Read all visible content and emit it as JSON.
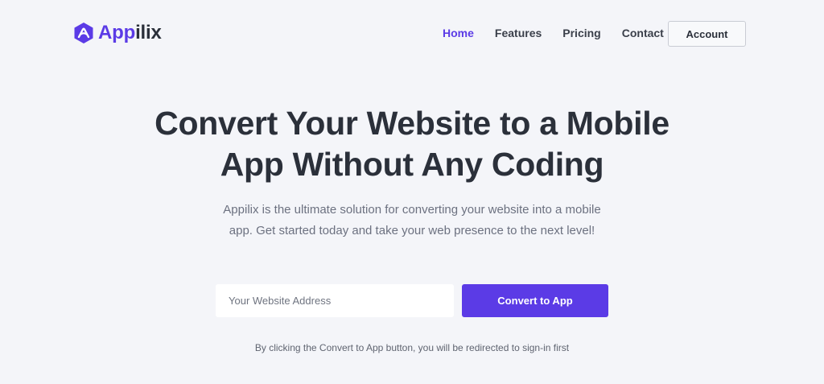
{
  "brand": {
    "name_part1": "App",
    "name_part2": "ilix",
    "accent_color": "#5b3be6",
    "logo_icon": "hexagon-logo-icon"
  },
  "nav": {
    "items": [
      {
        "label": "Home",
        "active": true
      },
      {
        "label": "Features",
        "active": false
      },
      {
        "label": "Pricing",
        "active": false
      },
      {
        "label": "Contact",
        "active": false
      }
    ],
    "account_label": "Account"
  },
  "hero": {
    "title_line1": "Convert Your Website to a Mobile",
    "title_line2": "App Without Any Coding",
    "subtitle": "Appilix is the ultimate solution for converting your website into a mobile app. Get started today and take your web presence to the next level!",
    "input_placeholder": "Your Website Address",
    "input_value": "",
    "cta_label": "Convert to App",
    "disclaimer": "By clicking the Convert to App button, you will be redirected to sign-in first"
  }
}
